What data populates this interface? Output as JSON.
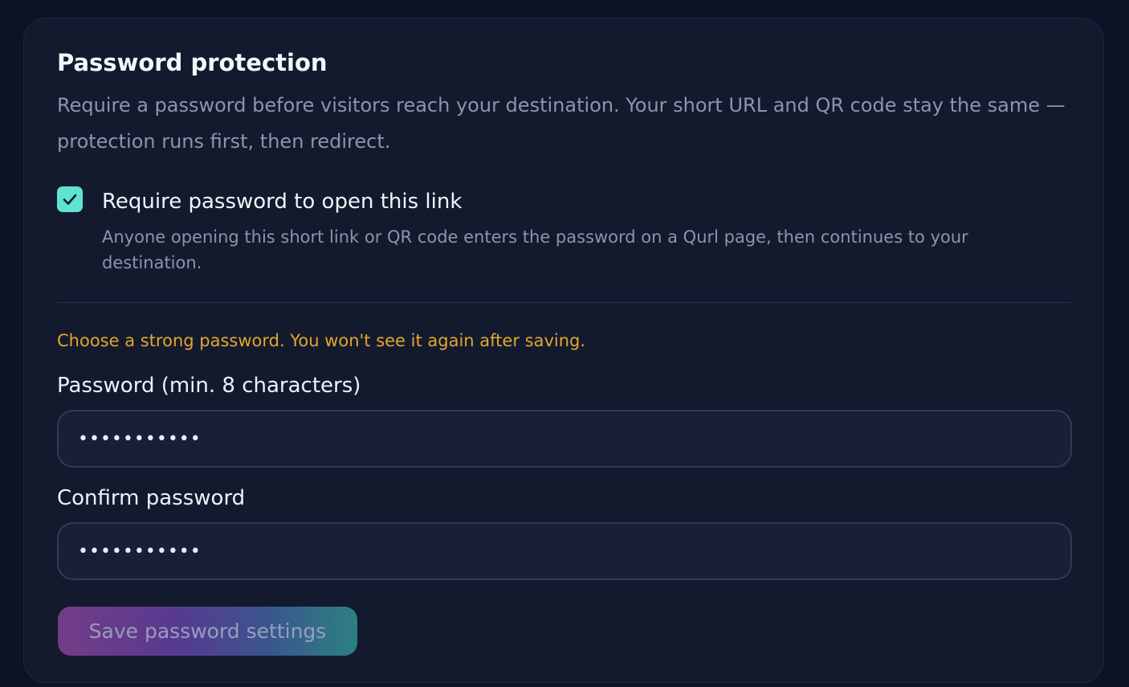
{
  "section": {
    "title": "Password protection",
    "description": "Require a password before visitors reach your destination. Your short URL and QR code stay the same — protection runs first, then redirect."
  },
  "require_password": {
    "checked": true,
    "label": "Require password to open this link",
    "help": "Anyone opening this short link or QR code enters the password on a Qurl page, then continues to your destination.",
    "check_icon": "check-icon"
  },
  "warning": "Choose a strong password. You won't see it again after saving.",
  "password_field": {
    "label": "Password (min. 8 characters)",
    "value": "•••••••••••"
  },
  "confirm_field": {
    "label": "Confirm password",
    "value": "•••••••••••"
  },
  "save_button": {
    "label": "Save password settings"
  },
  "colors": {
    "background": "#0c1327",
    "card": "#131a2e",
    "accent": "#5ee3cf",
    "warning": "#e3a62a"
  }
}
